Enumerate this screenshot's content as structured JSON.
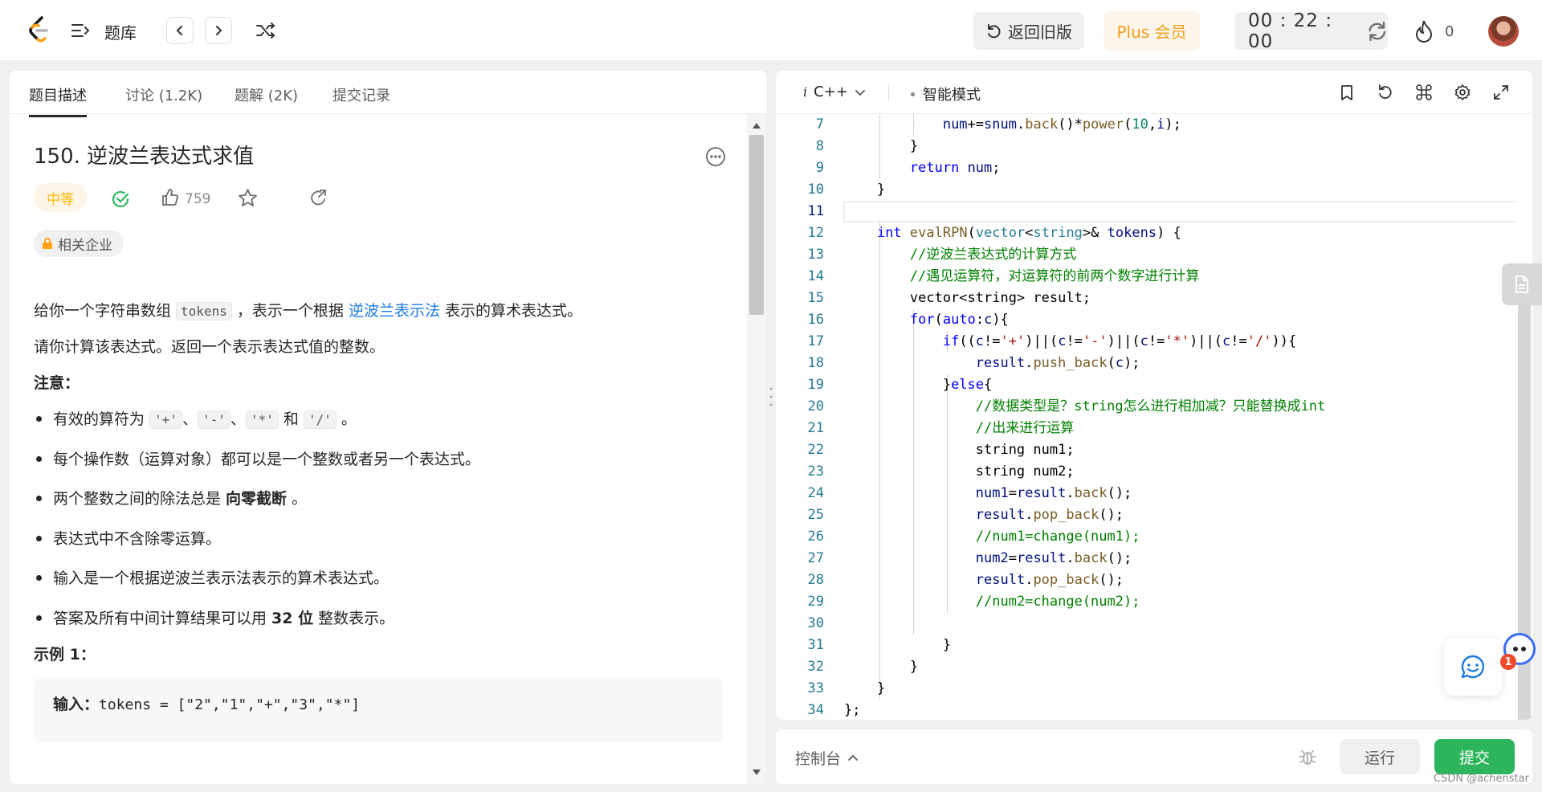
{
  "topbar": {
    "problem_bank": "题库",
    "old_version": "返回旧版",
    "plus": "Plus 会员",
    "timer": "00 : 22 : 00",
    "streak": "0"
  },
  "tabs": [
    {
      "label": "题目描述"
    },
    {
      "label": "讨论 (1.2K)"
    },
    {
      "label": "题解 (2K)"
    },
    {
      "label": "提交记录"
    }
  ],
  "problem": {
    "title": "150. 逆波兰表达式求值",
    "difficulty": "中等",
    "likes": "759",
    "company_tag": "相关企业",
    "p1": {
      "a": "给你一个字符串数组 ",
      "code": "tokens",
      "b": " ，表示一个根据 ",
      "link": "逆波兰表示法",
      "c": " 表示的算术表达式。"
    },
    "p2": "请你计算该表达式。返回一个表示表达式值的整数。",
    "note_heading": "注意：",
    "notes": {
      "n1": {
        "a": "有效的算符为 ",
        "op1": "'+'",
        "s1": "、",
        "op2": "'-'",
        "s2": "、",
        "op3": "'*'",
        "s3": " 和 ",
        "op4": "'/'",
        "end": " 。"
      },
      "n2": "每个操作数（运算对象）都可以是一个整数或者另一个表达式。",
      "n3": {
        "a": "两个整数之间的除法总是 ",
        "b": "向零截断",
        "c": " 。"
      },
      "n4": "表达式中不含除零运算。",
      "n5": "输入是一个根据逆波兰表示法表示的算术表达式。",
      "n6": {
        "a": "答案及所有中间计算结果可以用 ",
        "b": "32 位",
        "c": " 整数表示。"
      }
    },
    "example_heading": "示例 1：",
    "example_input_label": "输入：",
    "example_input_value": "tokens = [\"2\",\"1\",\"+\",\"3\",\"*\"]"
  },
  "editor": {
    "language": "C++",
    "mode": "智能模式",
    "line_numbers": [
      "7",
      "8",
      "9",
      "10",
      "11",
      "12",
      "13",
      "14",
      "15",
      "16",
      "17",
      "18",
      "19",
      "20",
      "21",
      "22",
      "23",
      "24",
      "25",
      "26",
      "27",
      "28",
      "29",
      "30",
      "31",
      "32",
      "33",
      "34"
    ],
    "current_line": "11"
  },
  "console": {
    "label": "控制台",
    "run": "运行",
    "submit": "提交"
  },
  "chat_badge": "1",
  "watermark": "CSDN @achenstar",
  "colors": {
    "accent_green": "#2db55d",
    "medium_orange": "#ffb800",
    "link_blue": "#1a7be0",
    "plus_orange": "#f0a020"
  }
}
